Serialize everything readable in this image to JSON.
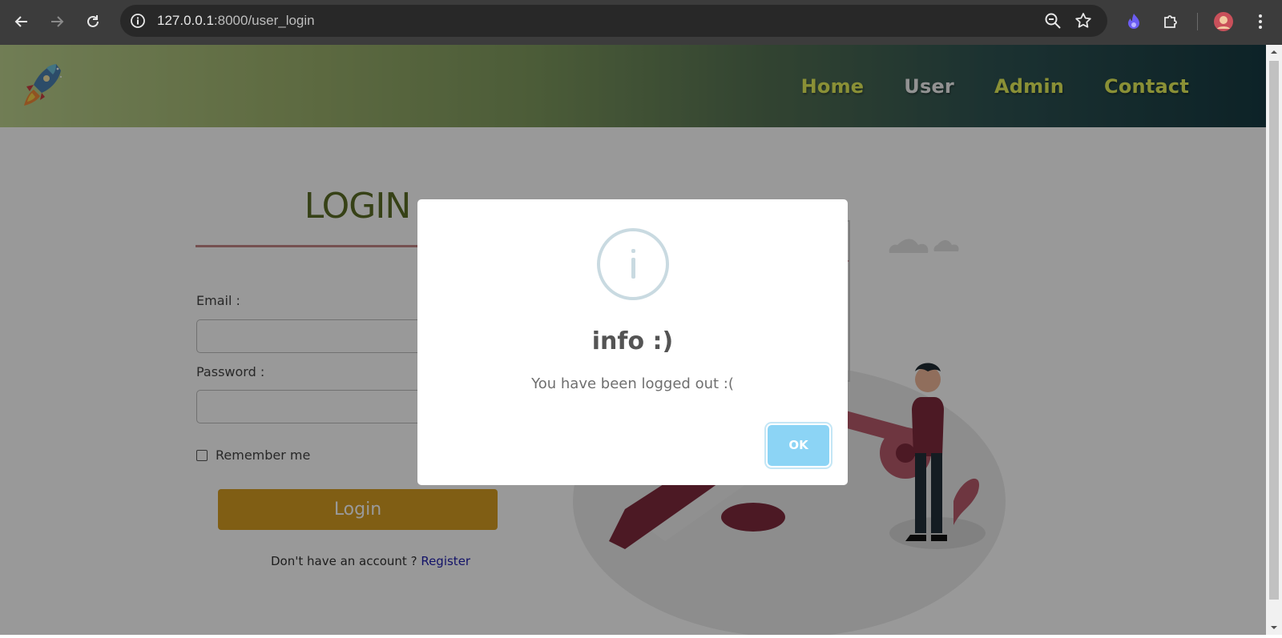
{
  "browser": {
    "url_host": "127.0.0.1",
    "url_rest": ":8000/user_login",
    "icons": [
      "back-icon",
      "forward-icon",
      "reload-icon",
      "site-info-icon",
      "zoom-icon",
      "bookmark-star-icon",
      "extension-flame-icon",
      "extensions-puzzle-icon",
      "profile-avatar",
      "menu-kebab-icon"
    ]
  },
  "site": {
    "nav": [
      {
        "label": "Home",
        "color": "#e6f15a"
      },
      {
        "label": "User",
        "color": "#f4f4f4"
      },
      {
        "label": "Admin",
        "color": "#e6f15a"
      },
      {
        "label": "Contact",
        "color": "#e6f15a"
      }
    ]
  },
  "login": {
    "title": "LOGIN",
    "email_label": "Email :",
    "password_label": "Password :",
    "remember_label": "Remember me",
    "button_label": "Login",
    "no_account_text": "Don't have an account ?",
    "register_link": "Register"
  },
  "modal": {
    "title": "info :)",
    "message": "You have been logged out :(",
    "ok_label": "OK",
    "icon": "info-icon"
  },
  "colors": {
    "login_button": "#d59d22",
    "title": "#5b6d25",
    "ok_button": "#8cd4f5"
  }
}
